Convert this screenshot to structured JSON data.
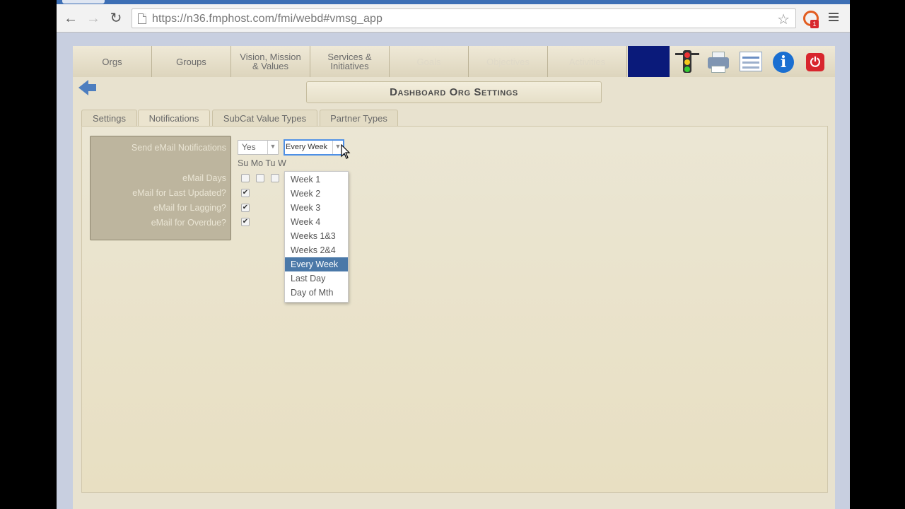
{
  "browser": {
    "url_text": "https://n36.fmphost.com/fmi/webd#vmsg_app",
    "back_icon": "arrow-left",
    "forward_icon": "arrow-right",
    "reload_icon": "reload",
    "bookmark_icon": "star",
    "ext_badge": "1"
  },
  "nav": {
    "tabs": [
      {
        "label": "Orgs"
      },
      {
        "label": "Groups"
      },
      {
        "label": "Vision, Mission\n& Values"
      },
      {
        "label": "Services &\nInitiatives"
      },
      {
        "label": "Goals"
      },
      {
        "label": "Objectives"
      },
      {
        "label": "Activities"
      }
    ]
  },
  "page": {
    "title": "Dashboard Org Settings"
  },
  "subtabs": [
    {
      "label": "Settings"
    },
    {
      "label": "Notifications"
    },
    {
      "label": "SubCat Value Types"
    },
    {
      "label": "Partner Types"
    }
  ],
  "form": {
    "send_email_label": "Send eMail Notifications",
    "send_email_value": "Yes",
    "frequency_value": "Every Week",
    "email_days_label": "eMail Days",
    "days_header": "Su Mo Tu W",
    "last_updated_label": "eMail for Last Updated?",
    "lagging_label": "eMail for Lagging?",
    "overdue_label": "eMail for Overdue?",
    "checkmark": "✔"
  },
  "dropdown": {
    "options": [
      "Week 1",
      "Week 2",
      "Week 3",
      "Week 4",
      "Weeks 1&3",
      "Weeks 2&4",
      "Every Week",
      "Last Day",
      "Day of Mth"
    ],
    "selected": "Every Week"
  },
  "colors": {
    "accent": "#4a78a8",
    "nav_dark": "#0a1a7a",
    "panel_bg": "#e8e2cf",
    "label_box": "#bdb59e"
  }
}
